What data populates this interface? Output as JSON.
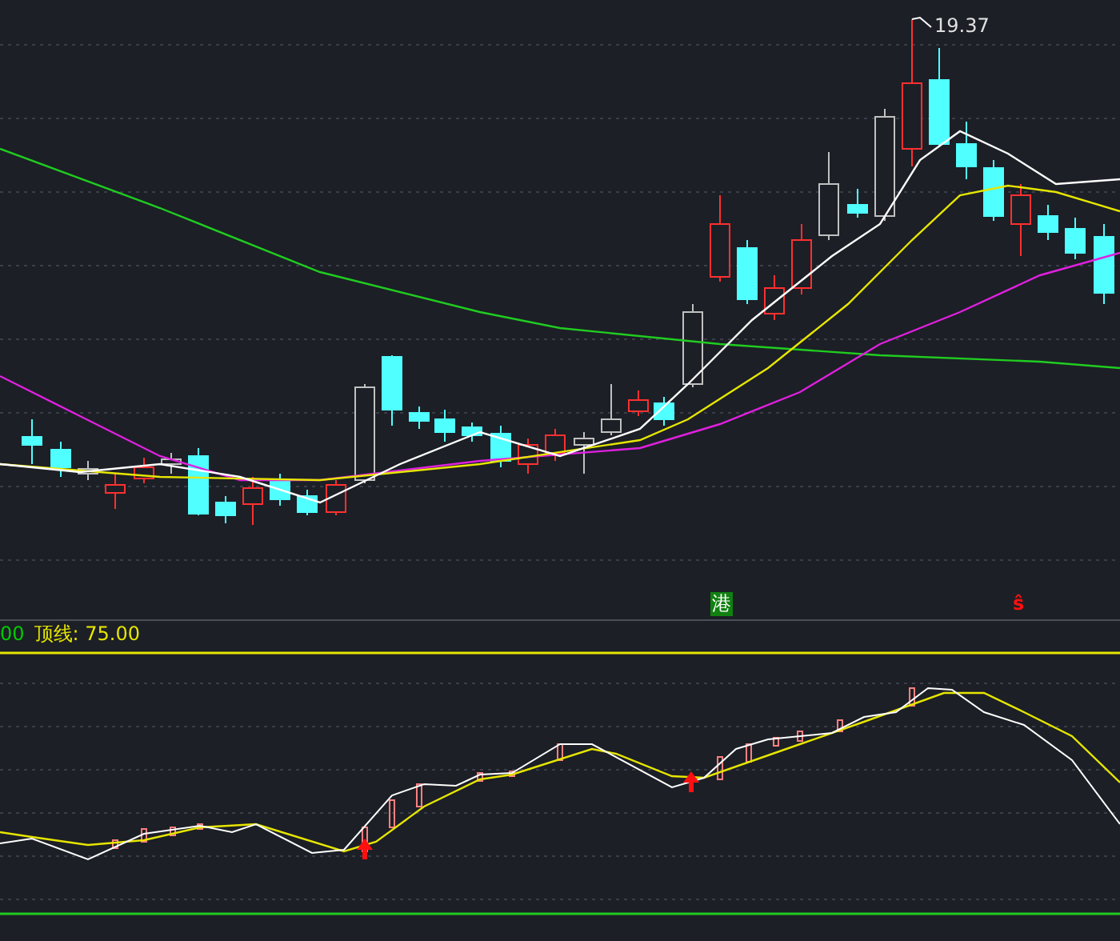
{
  "price_panel": {
    "high_label": "19.37",
    "markers": [
      {
        "text": "港",
        "kind": "tag"
      },
      {
        "text": "ŝ",
        "kind": "signal"
      }
    ]
  },
  "indicator_panel": {
    "values": [
      {
        "text": "00",
        "color": "#00cc00"
      },
      {
        "text": "顶线: 75.00",
        "color": "#e6e600"
      }
    ]
  }
}
